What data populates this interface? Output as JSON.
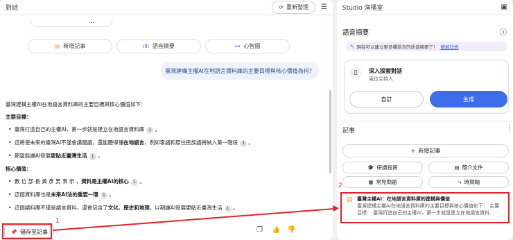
{
  "left_panel": {
    "title": "對話",
    "refresh_label": "重新整理",
    "ellipsis": "...",
    "tools": [
      {
        "label": "新增記事",
        "icon": "note-icon"
      },
      {
        "label": "語音摘要",
        "icon": "waveform-icon"
      },
      {
        "label": "心智圖",
        "icon": "mindmap-icon"
      }
    ],
    "user_question": "臺灣建構主權AI在地語言資料庫的主要目標與核心價值為何？",
    "answer": {
      "intro": "臺灣建構主權AI在地語言資料庫的主要目標與核心價值如下：",
      "h1": "主要目標：",
      "g1_a": "臺灣打造自己的主權AI，第一步就是建立在地語言資料庫",
      "g2_a": "這將使未來的臺灣AI不僅會講國語，還能聽得懂",
      "g2_b": "在地語言",
      "g2_c": "，例如客語和原住民族語將納入第一階段",
      "g3_a": "期望能讓AI發展",
      "g3_b": "更貼近臺灣生活",
      "h2": "核心價值：",
      "v1_a": "數 位 部 長 黃 彥 男 表 示 ，",
      "v1_b": "資料是主權AI的核心",
      "v2_a": "這個資料庫也是",
      "v2_b": "未來AI法的重要一環",
      "v3_a": "這個語料庫不僅是語言資料，還會包含了",
      "v3_b": "文化、歷史和地理",
      "v3_c": "，以期讓AI發展更貼近臺灣生活",
      "cite": "1"
    },
    "save_label": "儲存至記事",
    "annotation_1": "1"
  },
  "right_panel": {
    "title": "Studio 演播室",
    "audio_title": "語音摘要",
    "banner": "現在可以建立更多種語言的語音摘要了！",
    "banner_link": "瞭解詳情",
    "card_title": "深入探索對話",
    "card_sub": "兩位主持人",
    "customize": "自訂",
    "generate": "生成",
    "notes_title": "記事",
    "add_note": "新增記事",
    "chips": [
      "研讀指南",
      "簡介文件",
      "常見問題",
      "時間軸"
    ],
    "annotation_2": "2",
    "note_title": "臺灣主權AI：在地語言資料庫的建構與價值",
    "note_body": "臺灣建構主權AI在地語言資料庫的主要目標與核心價值如下： 主要目標： 臺灣打造自己的主權AI，第一步就是建立在地語言資料..."
  },
  "colors": {
    "accent": "#3b6ee8",
    "annotation": "#e0222a"
  }
}
